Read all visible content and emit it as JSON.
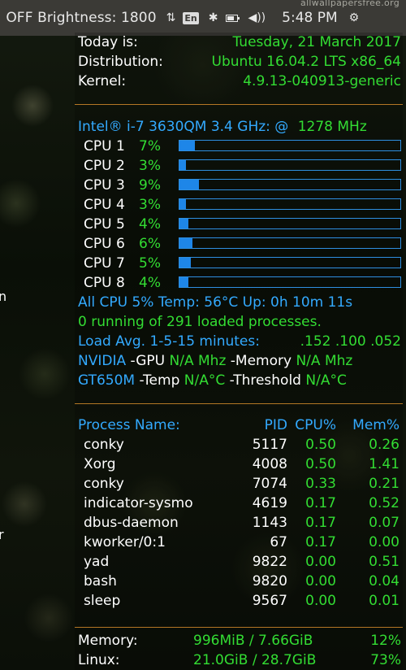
{
  "panel": {
    "brightness_text": ": OFF Brightness: 1800",
    "lang": "En",
    "clock": "5:48 PM",
    "battery_level": 0.7
  },
  "watermark": "allwallpapersfree.org",
  "edge_glyphs": [
    "n",
    "r"
  ],
  "system": {
    "today_label": "Today is:",
    "today_value": "Tuesday, 21 March 2017",
    "distribution_label": "Distribution:",
    "distribution_value": "Ubuntu 16.04.2 LTS x86_64",
    "kernel_label": "Kernel:",
    "kernel_value": "4.9.13-040913-generic"
  },
  "cpu": {
    "model": "Intel® i-7 3630QM 3.4 GHz: @",
    "freq": "1278 MHz",
    "cores": [
      {
        "label": "CPU 1",
        "usage": "7%",
        "percent": 7
      },
      {
        "label": "CPU 2",
        "usage": "3%",
        "percent": 3
      },
      {
        "label": "CPU 3",
        "usage": "9%",
        "percent": 9
      },
      {
        "label": "CPU 4",
        "usage": "3%",
        "percent": 3
      },
      {
        "label": "CPU 5",
        "usage": "4%",
        "percent": 4
      },
      {
        "label": "CPU 6",
        "usage": "6%",
        "percent": 6
      },
      {
        "label": "CPU 7",
        "usage": "5%",
        "percent": 5
      },
      {
        "label": "CPU 8",
        "usage": "4%",
        "percent": 4
      }
    ],
    "all_line": "All CPU 5%   Temp: 56°C  Up: 0h 10m 11s",
    "processes_line": "0 running of 291 loaded processes.",
    "load_label": "Load Avg. 1-5-15 minutes:",
    "load_value": ".152 .100 .052"
  },
  "gpu": {
    "name1": "NVIDIA",
    "gpu_label": " -GPU ",
    "gpu_value": "N/A Mhz",
    "memory_label": " -Memory ",
    "memory_value": "N/A Mhz",
    "name2": "GT650M",
    "temp_label": " -Temp ",
    "temp_value": "N/A°C",
    "threshold_label": "  -Threshold ",
    "threshold_value": "N/A°C"
  },
  "processes": {
    "headers": {
      "name": "Process Name:",
      "pid": "PID",
      "cpu": "CPU%",
      "mem": "Mem%"
    },
    "rows": [
      {
        "name": "conky",
        "pid": "5117",
        "cpu": "0.50",
        "mem": "0.26"
      },
      {
        "name": "Xorg",
        "pid": "4008",
        "cpu": "0.50",
        "mem": "1.41"
      },
      {
        "name": "conky",
        "pid": "7074",
        "cpu": "0.33",
        "mem": "0.21"
      },
      {
        "name": "indicator-sysmo",
        "pid": "4619",
        "cpu": "0.17",
        "mem": "0.52"
      },
      {
        "name": "dbus-daemon",
        "pid": "1143",
        "cpu": "0.17",
        "mem": "0.07"
      },
      {
        "name": "kworker/0:1",
        "pid": "67",
        "cpu": "0.17",
        "mem": "0.00"
      },
      {
        "name": "yad",
        "pid": "9822",
        "cpu": "0.00",
        "mem": "0.51"
      },
      {
        "name": "bash",
        "pid": "9820",
        "cpu": "0.00",
        "mem": "0.04"
      },
      {
        "name": "sleep",
        "pid": "9567",
        "cpu": "0.00",
        "mem": "0.01"
      }
    ]
  },
  "storage": {
    "memory_label": "Memory:",
    "memory_value": "996MiB / 7.66GiB",
    "memory_percent": "12%",
    "linux_label": "Linux:",
    "linux_value": "21.0GiB / 28.7GiB",
    "linux_percent": "73%"
  },
  "colors": {
    "green": "#33dd33",
    "blue": "#33aaff",
    "separator": "#d28a2a",
    "bar": "#1e86e8",
    "panel": "#3b3a36"
  },
  "icons": [
    "transfer-arrows-icon",
    "bluetooth-icon",
    "battery-icon",
    "volume-icon",
    "gear-icon"
  ]
}
